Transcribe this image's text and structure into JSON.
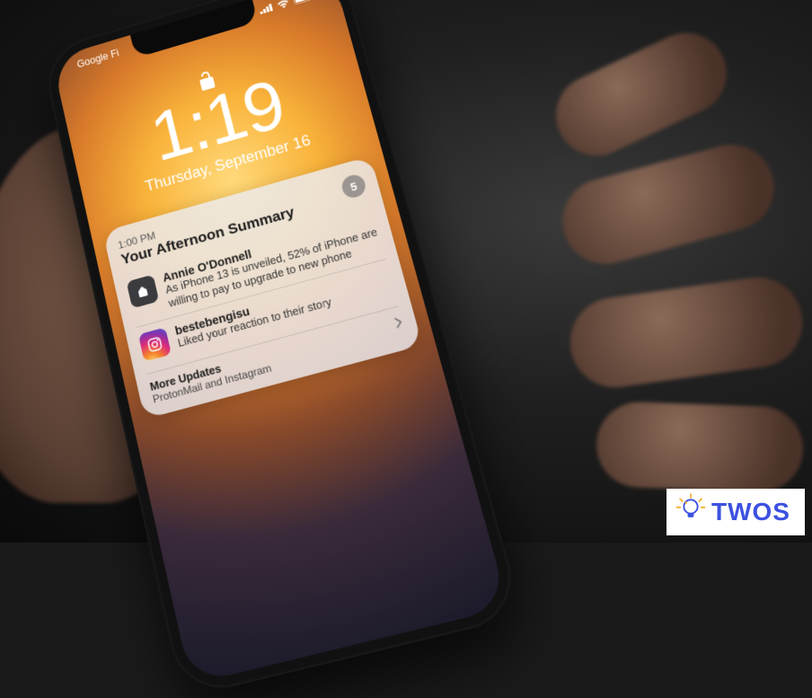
{
  "status_bar": {
    "carrier": "Google Fi"
  },
  "lockscreen": {
    "time": "1:19",
    "date": "Thursday, September 16"
  },
  "summary": {
    "time_label": "1:00 PM",
    "title": "Your Afternoon Summary",
    "count": "5",
    "notifications": [
      {
        "app": "apple-news",
        "sender": "Annie O'Donnell",
        "text": "As iPhone 13 is unveiled, 52% of iPhone are willing to pay to upgrade to new phone"
      },
      {
        "app": "instagram",
        "sender": "bestebengisu",
        "text": "Liked your reaction to their story"
      }
    ],
    "more": {
      "title": "More Updates",
      "text": "ProtonMail and Instagram"
    }
  },
  "watermark": {
    "text": "TWOS"
  }
}
